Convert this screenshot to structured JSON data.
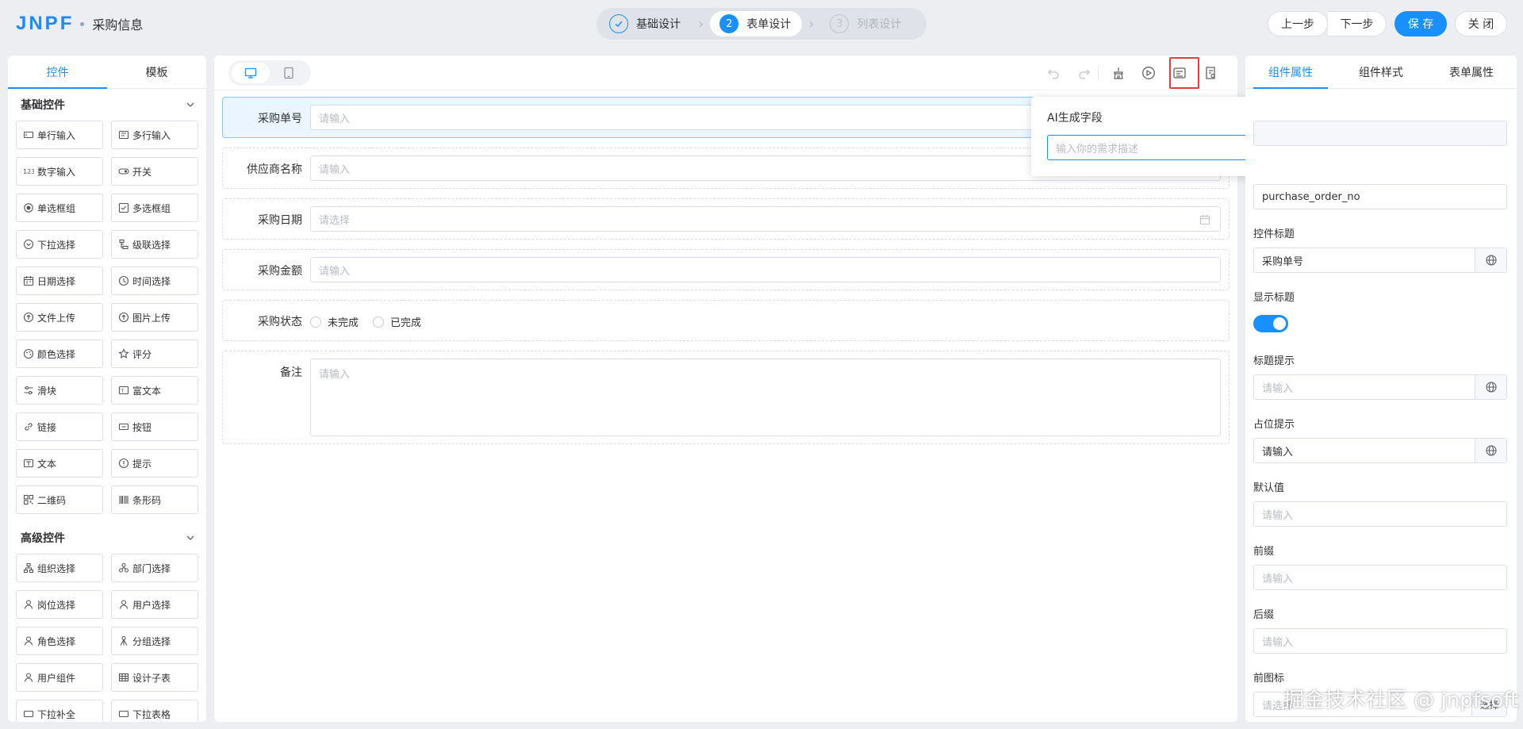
{
  "header": {
    "logo": "JNPF",
    "title": "采购信息",
    "steps": [
      {
        "num": "✓",
        "label": "基础设计",
        "state": "done"
      },
      {
        "num": "2",
        "label": "表单设计",
        "state": "current"
      },
      {
        "num": "3",
        "label": "列表设计",
        "state": "todo"
      }
    ],
    "prev_label": "上一步",
    "next_label": "下一步",
    "save_label": "保 存",
    "close_label": "关 闭"
  },
  "left_panel": {
    "tabs": [
      "控件",
      "模板"
    ],
    "basic_group": "基础控件",
    "basic_items": [
      {
        "icon": "single-line-input",
        "label": "单行输入"
      },
      {
        "icon": "multi-line-input",
        "label": "多行输入"
      },
      {
        "icon": "number-input",
        "label": "数字输入"
      },
      {
        "icon": "switch",
        "label": "开关"
      },
      {
        "icon": "radio",
        "label": "单选框组"
      },
      {
        "icon": "checkbox",
        "label": "多选框组"
      },
      {
        "icon": "dropdown",
        "label": "下拉选择"
      },
      {
        "icon": "cascader",
        "label": "级联选择"
      },
      {
        "icon": "calendar",
        "label": "日期选择"
      },
      {
        "icon": "clock",
        "label": "时间选择"
      },
      {
        "icon": "upload",
        "label": "文件上传"
      },
      {
        "icon": "image-upload",
        "label": "图片上传"
      },
      {
        "icon": "palette",
        "label": "颜色选择"
      },
      {
        "icon": "star",
        "label": "评分"
      },
      {
        "icon": "slider",
        "label": "滑块"
      },
      {
        "icon": "rich-text",
        "label": "富文本"
      },
      {
        "icon": "link",
        "label": "链接"
      },
      {
        "icon": "button",
        "label": "按钮"
      },
      {
        "icon": "text",
        "label": "文本"
      },
      {
        "icon": "info",
        "label": "提示"
      },
      {
        "icon": "qrcode",
        "label": "二维码"
      },
      {
        "icon": "barcode",
        "label": "条形码"
      }
    ],
    "advanced_group": "高级控件",
    "advanced_items": [
      {
        "icon": "org",
        "label": "组织选择"
      },
      {
        "icon": "dept",
        "label": "部门选择"
      },
      {
        "icon": "position",
        "label": "岗位选择"
      },
      {
        "icon": "user",
        "label": "用户选择"
      },
      {
        "icon": "role",
        "label": "角色选择"
      },
      {
        "icon": "group",
        "label": "分组选择"
      },
      {
        "icon": "user",
        "label": "用户组件"
      },
      {
        "icon": "table",
        "label": "设计子表"
      },
      {
        "icon": "misc",
        "label": "下拉补全"
      },
      {
        "icon": "misc",
        "label": "下拉表格"
      }
    ]
  },
  "canvas": {
    "fields": [
      {
        "label": "采购单号",
        "placeholder": "请输入"
      },
      {
        "label": "供应商名称",
        "placeholder": "请输入"
      },
      {
        "label": "采购日期",
        "placeholder": "请选择"
      },
      {
        "label": "采购金额",
        "placeholder": "请输入"
      }
    ],
    "status_label": "采购状态",
    "status_options": [
      "未完成",
      "已完成"
    ],
    "remark_label": "备注",
    "remark_placeholder": "请输入"
  },
  "ai_popup": {
    "title": "AI生成字段",
    "placeholder": "输入你的需求描述"
  },
  "right_panel": {
    "tabs": [
      "组件属性",
      "组件样式",
      "表单属性"
    ],
    "field_value": "purchase_order_no",
    "title_label": "控件标题",
    "title_value": "采购单号",
    "show_title_label": "显示标题",
    "show_title_on": true,
    "tip_label": "标题提示",
    "tip_placeholder": "请输入",
    "placeholder_label": "占位提示",
    "placeholder_value": "请输入",
    "default_label": "默认值",
    "default_placeholder": "请输入",
    "prefix_label": "前缀",
    "prefix_placeholder": "请输入",
    "suffix_label": "后缀",
    "suffix_placeholder": "请输入",
    "prefix_icon_label": "前图标",
    "prefix_icon_placeholder": "请选择",
    "prefix_icon_button": "选择"
  },
  "watermark": "掘金技术社区 @ jnpfsoft"
}
